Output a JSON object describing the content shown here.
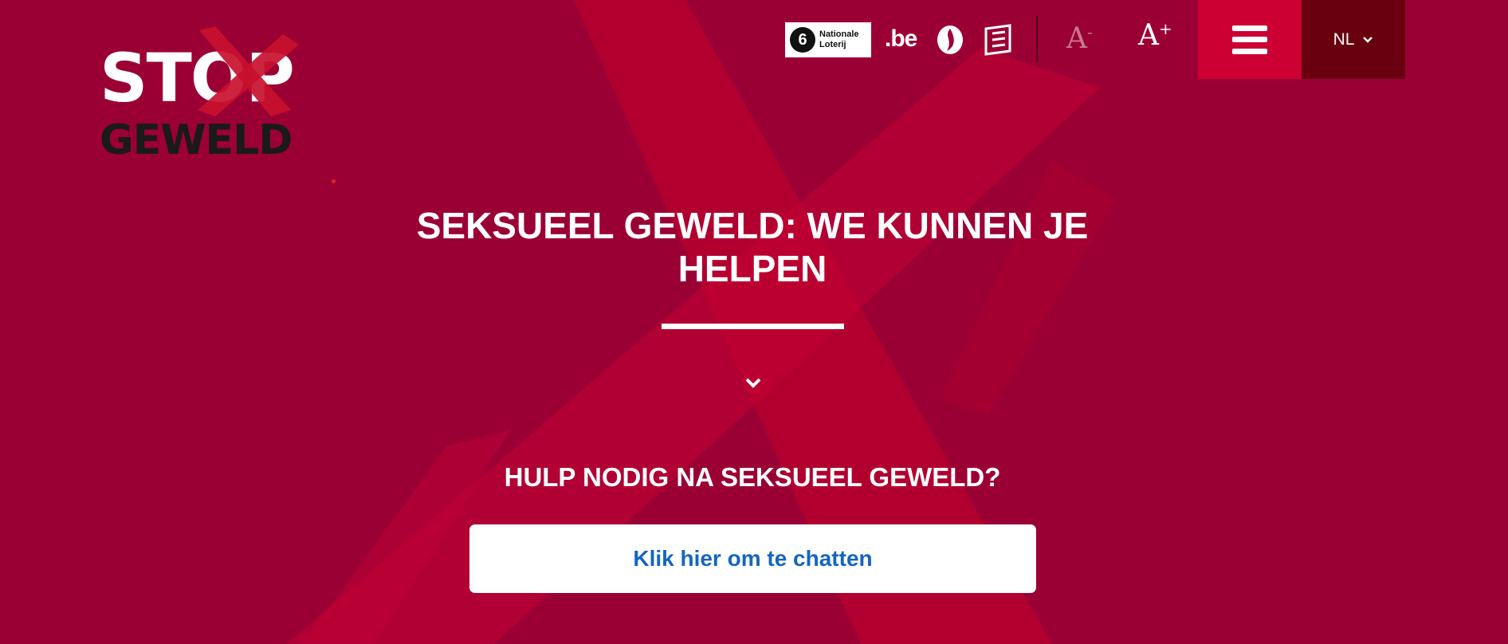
{
  "logo": {
    "line1": "STOP",
    "line2": "GEWELD"
  },
  "header": {
    "partner_logos": [
      {
        "name": "nationale-loterij",
        "text_line1": "Nationale",
        "text_line2": "Loterij",
        "number": "6"
      },
      {
        "name": "belgium-be",
        "text": ".be"
      },
      {
        "name": "flame-icon"
      },
      {
        "name": "book-icon"
      }
    ],
    "font_decrease": {
      "letter": "A",
      "sign": "-"
    },
    "font_increase": {
      "letter": "A",
      "sign": "+"
    },
    "menu": {
      "icon": "hamburger-icon"
    },
    "language": {
      "label": "NL",
      "icon": "chevron-down-icon"
    }
  },
  "hero": {
    "title": "SEKSUEEL GEWELD: WE KUNNEN JE HELPEN",
    "scroll_icon": "chevron-down-icon"
  },
  "help": {
    "title": "HULP NODIG NA SEKSUEEL GEWELD?",
    "button_label": "Klik hier om te chatten"
  },
  "colors": {
    "background": "#9b0034",
    "menu_button": "#cc0033",
    "language_button": "#68000f",
    "chat_button_text": "#1565c0"
  }
}
